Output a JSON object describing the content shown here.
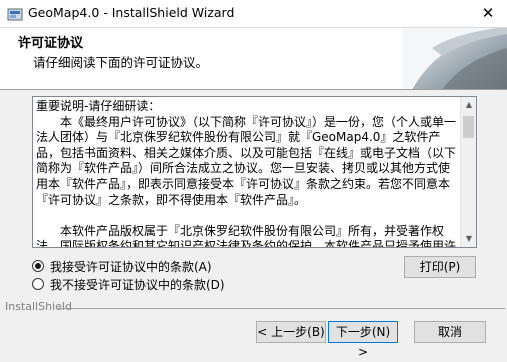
{
  "window": {
    "title": "GeoMap4.0 - InstallShield Wizard",
    "close_label": "✕"
  },
  "header": {
    "title": "许可证协议",
    "subtitle": "请仔细阅读下面的许可证协议。"
  },
  "license": {
    "text": "重要说明-请仔细研读：\n　　本《最终用户许可协议》（以下简称『许可协议』）是一份，您（个人或单一法人团体）与『北京侏罗纪软件股份有限公司』就『GeoMap4.0』之软件产品，包括书面资料、相关之媒体介质、以及可能包括『在线』或电子文档（以下简称为『软件产品』）间所合法成立之协议。您一旦安装、拷贝或以其他方式使用本『软件产品』，即表示同意接受本『许可协议』条款之约束。若您不同意本『许可协议』之条款，即不得使用本『软件产品』。\n\n　　本软件产品版权属于『北京侏罗纪软件股份有限公司』所有，并受著作权法、国际版权条约和其它知识产权法律及条约的保护。本软件产品只授予使用许可，并不出售。"
  },
  "options": {
    "accept_label": "我接受许可证协议中的条款(A)",
    "decline_label": "我不接受许可证协议中的条款(D)",
    "selected": "accept"
  },
  "buttons": {
    "print_label": "打印(P)",
    "back_label": "< 上一步(B)",
    "next_label": "下一步(N) >",
    "cancel_label": "取消"
  },
  "footer": {
    "brand_label": "InstallShield"
  },
  "colors": {
    "accent": "#0078d7",
    "header_bg": "#ffffff",
    "dialog_bg": "#f0f0f0"
  }
}
